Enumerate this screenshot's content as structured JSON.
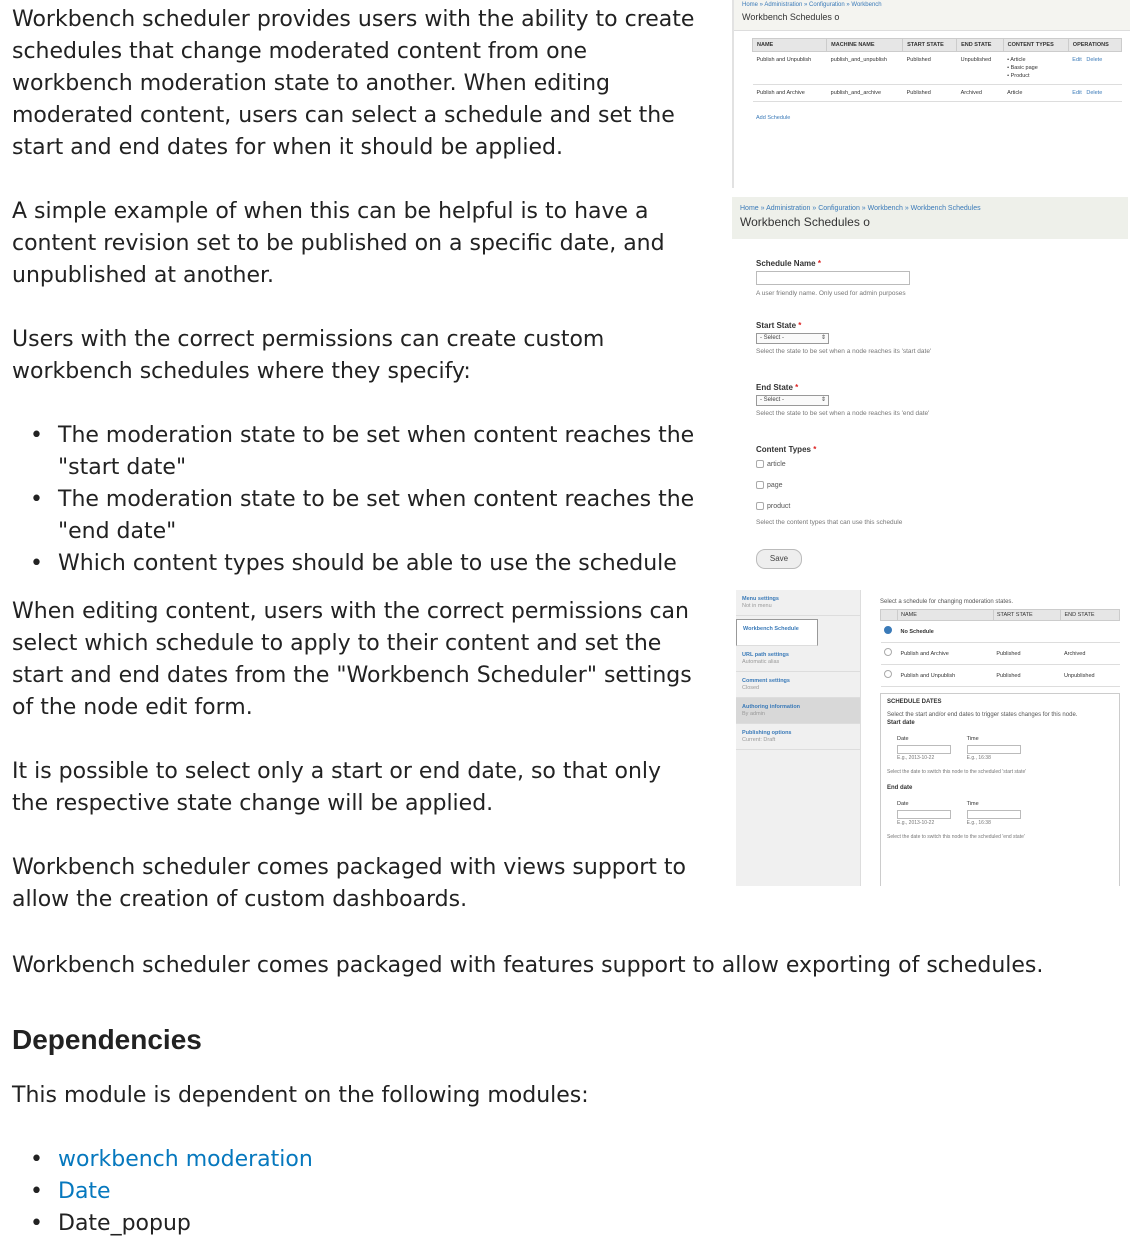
{
  "intro": "Workbench scheduler provides users with the ability to create schedules that change moderated content from one workbench moderation state to another. When editing moderated content, users can select a schedule and set the start and end dates for when it should be applied.",
  "example": "A simple example of when this can be helpful is to have a content revision set to be published on a specific date, and unpublished at another.",
  "permissions_intro": "Users with the correct permissions can create custom workbench schedules where they specify:",
  "specify_items": [
    "The moderation state to be set when content reaches the \"start date\"",
    "The moderation state to be set when content reaches the \"end date\"",
    "Which content types should be able to use the schedule"
  ],
  "editing": "When editing content, users with the correct permissions can select which schedule to apply to their content and set the start and end dates from the \"Workbench Scheduler\" settings of the node edit form.",
  "only_one": "It is possible to select only a start or end date, so that only the respective state change will be applied.",
  "views": "Workbench scheduler comes packaged with views support to allow the creation of custom dashboards.",
  "features": "Workbench scheduler comes packaged with features support to allow exporting of schedules.",
  "dependencies_heading": "Dependencies",
  "dependencies_intro": "This module is dependent on the following modules:",
  "dependencies": [
    {
      "label": "workbench moderation",
      "link": true
    },
    {
      "label": "Date",
      "link": true
    },
    {
      "label": "Date_popup",
      "link": false
    }
  ],
  "screenshot1": {
    "breadcrumb": "Home » Administration » Configuration » Workbench",
    "title": "Workbench Schedules",
    "headers": [
      "NAME",
      "MACHINE NAME",
      "START STATE",
      "END STATE",
      "CONTENT TYPES",
      "OPERATIONS"
    ],
    "rows": [
      {
        "name": "Publish and Unpublish",
        "machine": "publish_and_unpublish",
        "start": "Published",
        "end": "Unpublished",
        "types": [
          "Article",
          "Basic page",
          "Product"
        ],
        "edit": "Edit",
        "delete": "Delete"
      },
      {
        "name": "Publish and Archive",
        "machine": "publish_and_archive",
        "start": "Published",
        "end": "Archived",
        "types": [
          "Article"
        ],
        "edit": "Edit",
        "delete": "Delete"
      }
    ],
    "add_link": "Add Schedule"
  },
  "screenshot2": {
    "breadcrumb": "Home » Administration » Configuration » Workbench » Workbench Schedules",
    "title": "Workbench Schedules",
    "name_label": "Schedule Name",
    "name_desc": "A user friendly name. Only used for admin purposes",
    "start_label": "Start State",
    "start_select": "- Select -",
    "start_desc": "Select the state to be set when a node reaches its 'start date'",
    "end_label": "End State",
    "end_select": "- Select -",
    "end_desc": "Select the state to be set when a node reaches its 'end date'",
    "types_label": "Content Types",
    "types": [
      "article",
      "page",
      "product"
    ],
    "types_desc": "Select the content types that can use this schedule",
    "save": "Save"
  },
  "screenshot3": {
    "tabs": [
      {
        "title": "Menu settings",
        "sub": "Not in menu"
      },
      {
        "title": "Workbench Schedule",
        "sub": ""
      },
      {
        "title": "URL path settings",
        "sub": "Automatic alias"
      },
      {
        "title": "Comment settings",
        "sub": "Closed"
      },
      {
        "title": "Authoring information",
        "sub": "By admin"
      },
      {
        "title": "Publishing options",
        "sub": "Current: Draft"
      }
    ],
    "instruction": "Select a schedule for changing moderation states.",
    "headers": [
      "NAME",
      "START STATE",
      "END STATE"
    ],
    "rows": [
      {
        "name": "No Schedule",
        "start": "",
        "end": ""
      },
      {
        "name": "Publish and Archive",
        "start": "Published",
        "end": "Archived"
      },
      {
        "name": "Publish and Unpublish",
        "start": "Published",
        "end": "Unpublished"
      }
    ],
    "dates_legend": "SCHEDULE DATES",
    "dates_desc": "Select the start and/or end dates to trigger states changes for this node.",
    "start_date": "Start date",
    "end_date": "End date",
    "date_label": "Date",
    "time_label": "Time",
    "date_eg": "E.g., 2013-10-22",
    "time_eg": "E.g., 16:38",
    "start_note": "Select the date to switch this node to the scheduled 'start state'",
    "end_note": "Select the date to switch this node to the scheduled 'end state'"
  }
}
